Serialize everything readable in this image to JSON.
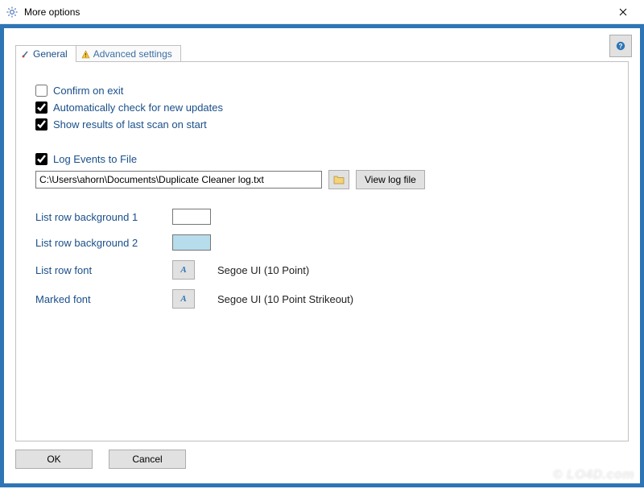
{
  "window": {
    "title": "More options"
  },
  "tabs": {
    "general": "General",
    "advanced": "Advanced settings"
  },
  "checkboxes": {
    "confirmExit": {
      "label": "Confirm on exit",
      "checked": false
    },
    "autoUpdate": {
      "label": "Automatically check for new updates",
      "checked": true
    },
    "showResults": {
      "label": "Show results of last scan on start",
      "checked": true
    },
    "logEvents": {
      "label": "Log Events to File",
      "checked": true
    }
  },
  "logPath": "C:\\Users\\ahorn\\Documents\\Duplicate Cleaner log.txt",
  "viewLogLabel": "View log file",
  "styleRows": {
    "bg1": "List row background 1",
    "bg2": "List row background 2",
    "rowFont": "List row font",
    "rowFontDesc": "Segoe UI (10 Point)",
    "markedFont": "Marked font",
    "markedFontDesc": "Segoe UI (10 Point Strikeout)"
  },
  "colors": {
    "bg1": "#ffffff",
    "bg2": "#b7ddec"
  },
  "buttons": {
    "ok": "OK",
    "cancel": "Cancel"
  },
  "watermark": "© LO4D.com"
}
